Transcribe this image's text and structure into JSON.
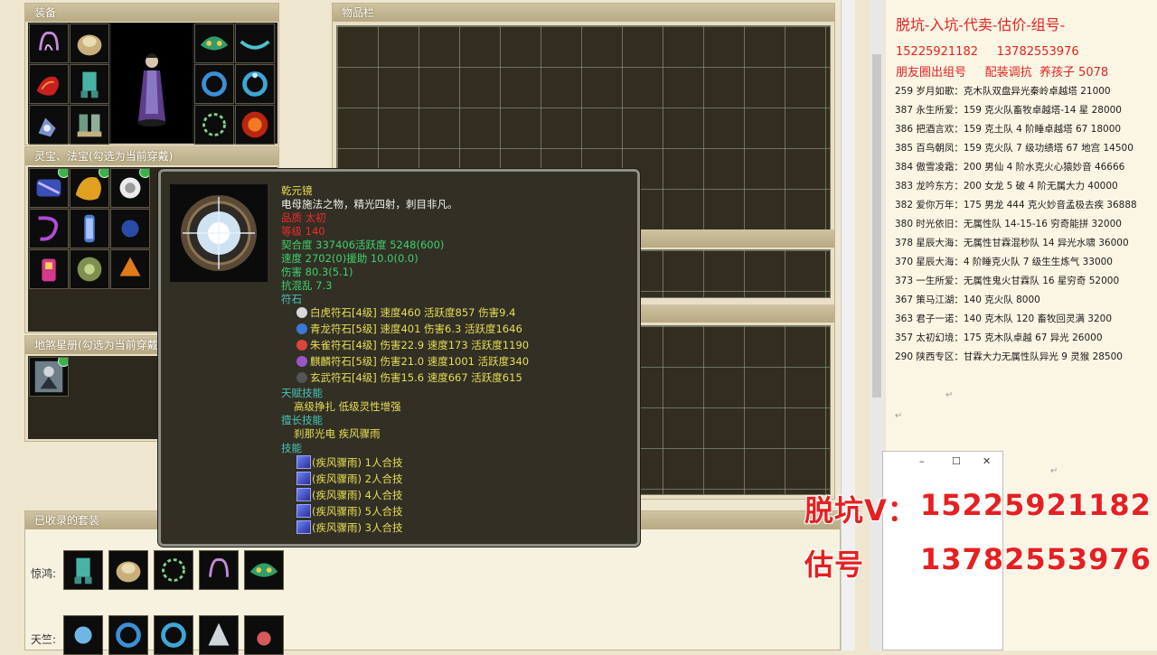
{
  "equipment": {
    "title": "装备"
  },
  "lingbao": {
    "title": "灵宝、法宝(勾选为当前穿戴)"
  },
  "disha": {
    "title": "地煞星册(勾选为当前穿戴)"
  },
  "inventory": {
    "title": "物品栏"
  },
  "suits": {
    "title": "已收录的套装",
    "rows": [
      {
        "label": "惊鸿:"
      },
      {
        "label": "天竺:"
      }
    ]
  },
  "tooltip": {
    "name": "乾元镜",
    "desc": "电母施法之物，精光四射，刺目非凡。",
    "quality": "品质  太初",
    "level": "等级  140",
    "fit": "契合度     337406活跃度     5248(600)",
    "speed": "速度     2702(0)援助     10.0(0.0)",
    "damage": "伤害     80.3(5.1)",
    "kanghunluan": "抗混乱 7.3",
    "runes_label": "符石",
    "runes": [
      {
        "text": "白虎符石[4级] 速度460 活跃度857 伤害9.4",
        "color": "#d8d8d8"
      },
      {
        "text": "青龙符石[5级] 速度401 伤害6.3 活跃度1646",
        "color": "#3b79d9"
      },
      {
        "text": "朱雀符石[4级] 伤害22.9 速度173 活跃度1190",
        "color": "#d9473b"
      },
      {
        "text": "麒麟符石[5级] 伤害21.0 速度1001 活跃度340",
        "color": "#9b55c9"
      },
      {
        "text": "玄武符石[4级] 伤害15.6 速度667 活跃度615",
        "color": "#454545"
      }
    ],
    "tianfu_label": "天赋技能",
    "tianfu_value": "高级挣扎     低级灵性增强",
    "shanchang_label": "擅长技能",
    "shanchang_value": "刹那光电     疾风骤雨",
    "skills_label": "技能",
    "skills": [
      "(疾风骤雨) 1人合技",
      "(疾风骤雨) 2人合技",
      "(疾风骤雨) 4人合技",
      "(疾风骤雨) 5人合技",
      "(疾风骤雨) 3人合技"
    ]
  },
  "notes": {
    "header": "脱坑-入坑-代卖-估价-组号-",
    "phones": "15225921182     13782553976",
    "line3": "朋友圈出组号     配装调抗  养孩子 5078",
    "rows": [
      "259 岁月如歌：克木队双盘异光秦岭卓越塔 21000",
      "387 永生所爱：159 克火队畜牧卓越塔-14 星 28000",
      "386 把酒言欢：159 克土队 4 阶睡卓越塔 67  18000",
      "385 百鸟朝凤：159 克火队 7 级功绩塔 67 地宫 14500",
      "384 傲雪凌霜：200 男仙 4 阶水克火心猿妙音 46666",
      "383 龙吟东方：200 女龙 5 破 4 阶无属大力 40000",
      "382 爱你万年：175 男龙 444 克火妙音孟极去疾 36888",
      "380 时光依旧：无属性队 14-15-16 穷奇能拼 32000",
      "378 星辰大海：无属性甘霖混秒队 14 异光水啸 36000",
      "370 星辰大海：4 阶睡克火队 7 级生生炼气 33000",
      "373 一生所爱：无属性鬼火甘霖队 16 星穷奇 52000",
      "367 策马江湖：140 克火队 8000",
      "363 君子一诺：140 克木队 120 畜牧回灵满 3200",
      "357 太初幻境：175 克木队卓越 67 异光 26000",
      "290 陕西专区：甘霖大力无属性队异光 9 灵猴 28500"
    ]
  },
  "overlay": {
    "line1_label": "脱坑V：",
    "line1_number": "15225921182",
    "line2_label": "估号",
    "line2_number": "13782553976"
  },
  "mini_window": {
    "minimize": "–",
    "maximize": "☐",
    "close": "✕"
  },
  "colors": {
    "accent_red": "#e62020",
    "tooltip_bg": "#322f25",
    "item_name": "#e8df54",
    "stat_green": "#3ed26e"
  }
}
